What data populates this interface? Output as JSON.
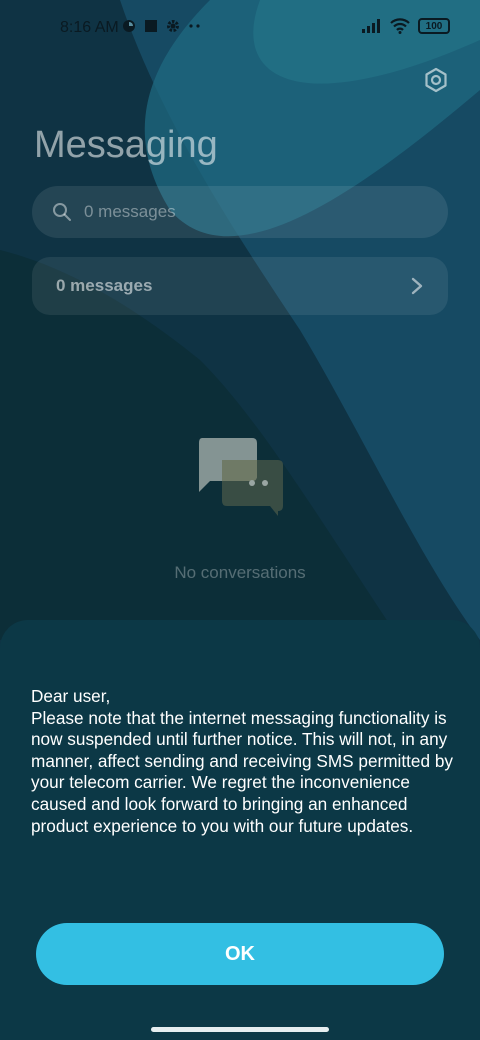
{
  "status_bar": {
    "time": "8:16 AM",
    "battery": "100",
    "icons_left": [
      "sync-icon",
      "square-app-icon",
      "gear-icon",
      "more-dots-icon"
    ],
    "icons_right": [
      "signal-icon",
      "wifi-icon",
      "battery-icon"
    ]
  },
  "header": {
    "title": "Messaging",
    "settings_icon": "settings-hexagon-icon"
  },
  "search": {
    "placeholder": "0 messages"
  },
  "messages_card": {
    "label": "0 messages"
  },
  "empty_state": {
    "icon": "chat-bubbles-icon",
    "text": "No conversations"
  },
  "dialog": {
    "message": "Dear user,\nPlease note that the internet messaging functionality is now suspended until further notice. This will not, in any manner, affect sending and receiving SMS permitted by your telecom carrier. We regret the inconvenience caused and look forward to bringing an enhanced product experience to you with our future updates.",
    "ok_label": "OK"
  },
  "colors": {
    "accent": "#33bfe3",
    "sheet_bg": "#0c3846",
    "background": "#0f3344"
  }
}
